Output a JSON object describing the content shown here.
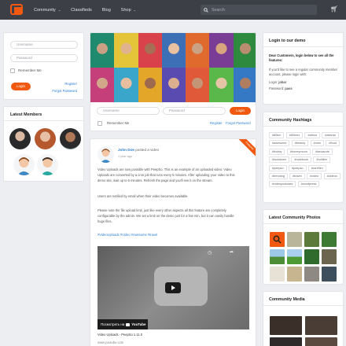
{
  "nav": {
    "items": [
      "Community",
      "Classifieds",
      "Blog",
      "Shop"
    ],
    "search_placeholder": "Search"
  },
  "login": {
    "username_placeholder": "Username",
    "password_placeholder": "Password",
    "remember": "Remember Me",
    "login_btn": "Login",
    "register": "Register",
    "forgot": "Forgot Password"
  },
  "members": {
    "title": "Latest Members"
  },
  "hero_login": {
    "username_placeholder": "Username",
    "password_placeholder": "Password",
    "login_btn": "Login",
    "remember": "Remember Me",
    "register": "Register",
    "forgot": "Forgot Password"
  },
  "post": {
    "author": "John Doe",
    "action": "posted a video",
    "time": "1 year ago",
    "ribbon": "Featured",
    "p1": [
      "Video Uploads are now possible with PeepSo. This is an example of an uploaded video. Video",
      "Uploads are converted by a cron job that runs every 5 minutes. After uploading your video to this",
      "demo site, wait up to 5 minutes. Refresh the page and you'll see it on the stream."
    ],
    "p2": "Users are notified by email when their video becomes available.",
    "p3": [
      "Please note the file upload limit, just like every other aspects all this feature are completely",
      "configurable by the admin. We set a limit on the demo just for a few min, but it can easily handle",
      "huge files."
    ],
    "hashtags": "#VideoUploads #Video #Awesome #travel",
    "video_watch": "Посмотреть на",
    "video_brand": "YouTube",
    "video_title": "Video Uploads - PeepSo 1.11.0",
    "video_url": "www.youtube.com"
  },
  "demo": {
    "title": "Login to our demo",
    "intro": "Dear Customers, login below to see all the features:",
    "body": "If you'd like to see a regular community member account, please login with:",
    "login_label": "Login:",
    "login_value": "jobar",
    "pass_label": "Password:",
    "pass_value": "pass"
  },
  "hashtags": {
    "title": "Community Hashtags",
    "tags": [
      "#80km",
      "#80kms",
      "#africa",
      "#atlanta",
      "#awesome",
      "#beauty",
      "#cars",
      "#food",
      "#hobby",
      "#honeymoon",
      "#lanzarote",
      "#lockdown",
      "#notebook",
      "#nofilter",
      "#peepso",
      "#peepso",
      "#rarefilm",
      "#trending",
      "#travel",
      "#video",
      "#videos",
      "#videopodcasts",
      "#wordpress"
    ]
  },
  "photos": {
    "title": "Latest Community Photos"
  },
  "media": {
    "title": "Community Media"
  },
  "colors": {
    "accent": "#f0590f",
    "link": "#2d7fd3",
    "topbar": "#3c3f46"
  }
}
